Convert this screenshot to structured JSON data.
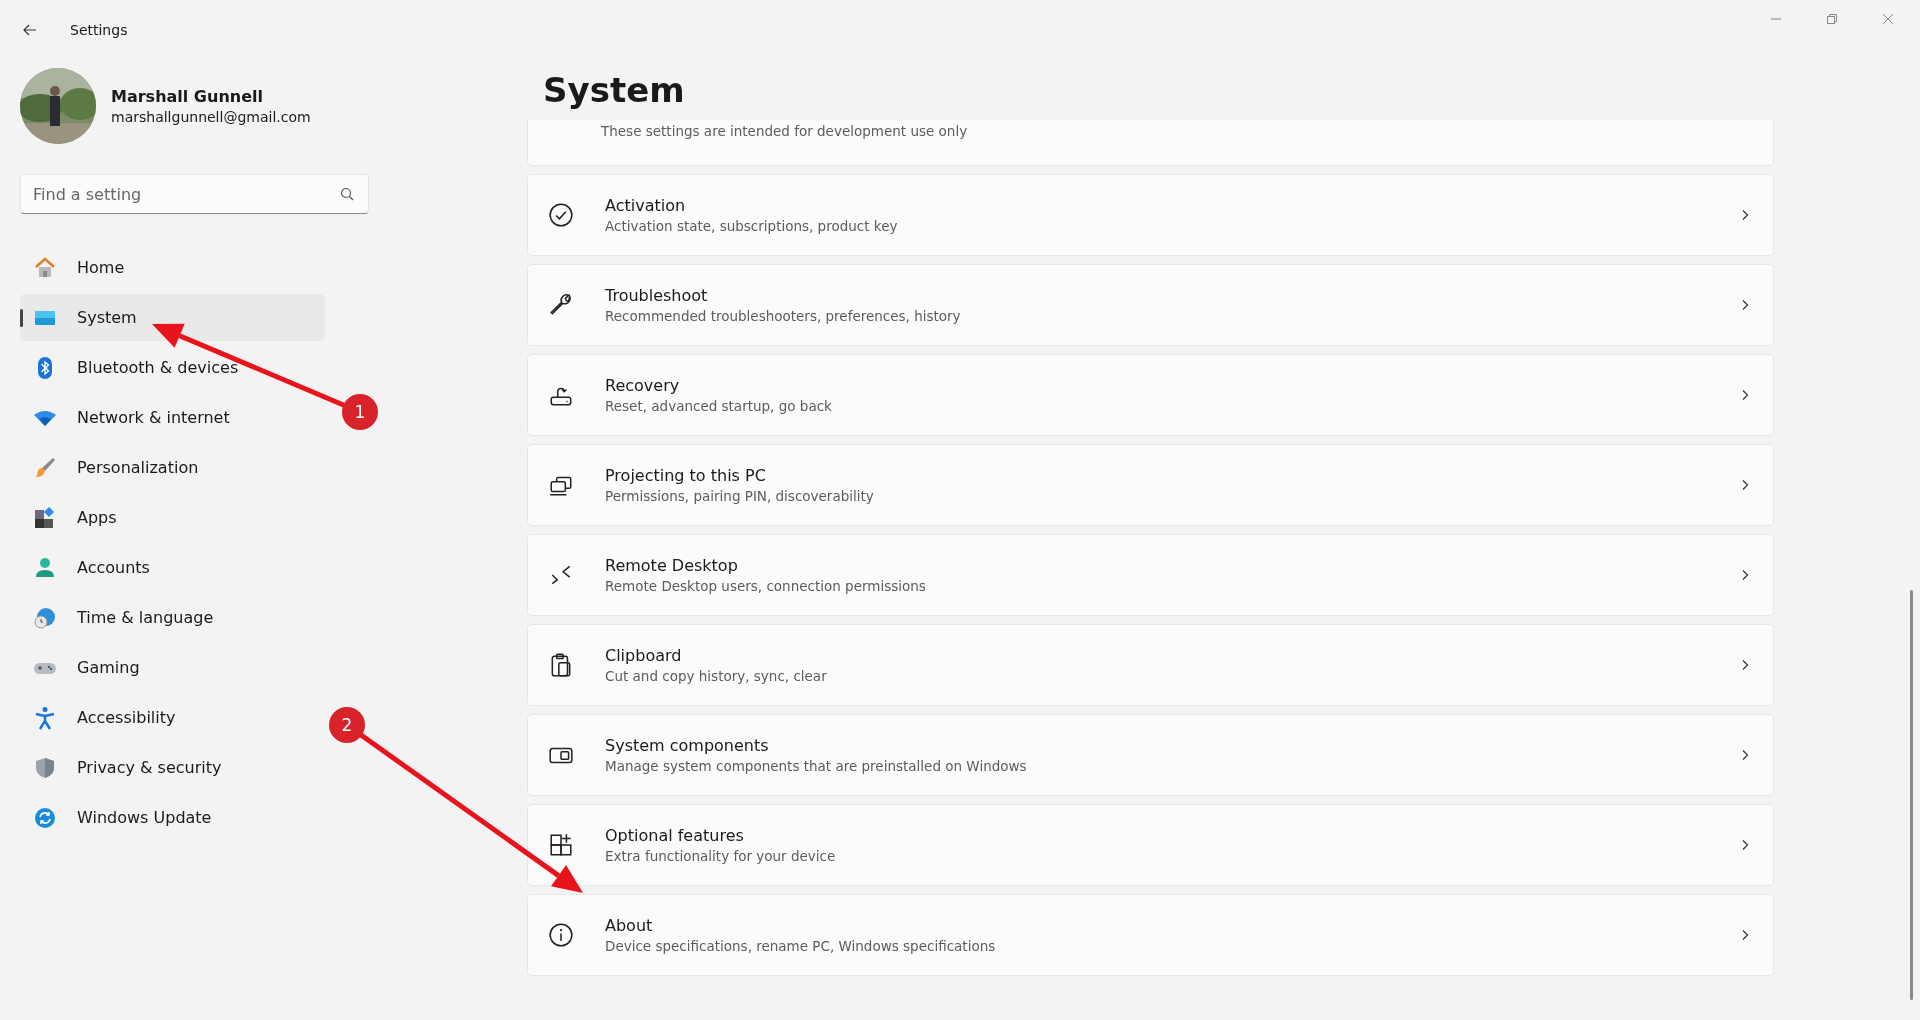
{
  "window": {
    "title": "Settings"
  },
  "profile": {
    "name": "Marshall Gunnell",
    "email": "marshallgunnell@gmail.com"
  },
  "search": {
    "placeholder": "Find a setting"
  },
  "sidebar": {
    "items": [
      {
        "label": "Home",
        "selected": false
      },
      {
        "label": "System",
        "selected": true
      },
      {
        "label": "Bluetooth & devices",
        "selected": false
      },
      {
        "label": "Network & internet",
        "selected": false
      },
      {
        "label": "Personalization",
        "selected": false
      },
      {
        "label": "Apps",
        "selected": false
      },
      {
        "label": "Accounts",
        "selected": false
      },
      {
        "label": "Time & language",
        "selected": false
      },
      {
        "label": "Gaming",
        "selected": false
      },
      {
        "label": "Accessibility",
        "selected": false
      },
      {
        "label": "Privacy & security",
        "selected": false
      },
      {
        "label": "Windows Update",
        "selected": false
      }
    ]
  },
  "page": {
    "title": "System",
    "partial_card": {
      "description": "These settings are intended for development use only"
    },
    "cards": [
      {
        "title": "Activation",
        "description": "Activation state, subscriptions, product key"
      },
      {
        "title": "Troubleshoot",
        "description": "Recommended troubleshooters, preferences, history"
      },
      {
        "title": "Recovery",
        "description": "Reset, advanced startup, go back"
      },
      {
        "title": "Projecting to this PC",
        "description": "Permissions, pairing PIN, discoverability"
      },
      {
        "title": "Remote Desktop",
        "description": "Remote Desktop users, connection permissions"
      },
      {
        "title": "Clipboard",
        "description": "Cut and copy history, sync, clear"
      },
      {
        "title": "System components",
        "description": "Manage system components that are preinstalled on Windows"
      },
      {
        "title": "Optional features",
        "description": "Extra functionality for your device"
      },
      {
        "title": "About",
        "description": "Device specifications, rename PC, Windows specifications"
      }
    ]
  },
  "annotations": [
    {
      "label": "1"
    },
    {
      "label": "2"
    }
  ]
}
